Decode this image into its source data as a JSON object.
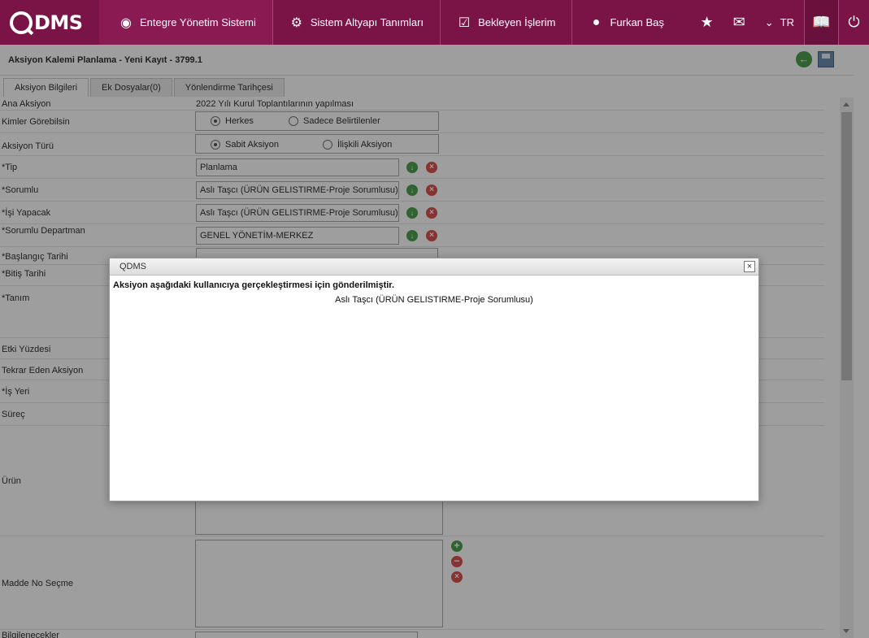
{
  "nav": {
    "logo_text": "DMS",
    "items": [
      {
        "label": "Entegre Yönetim Sistemi",
        "icon": "q-logo-icon"
      },
      {
        "label": "Sistem Altyapı Tanımları",
        "icon": "gear-icon"
      },
      {
        "label": "Bekleyen İşlerim",
        "icon": "clipboard-icon"
      },
      {
        "label": "Furkan Baş",
        "icon": "user-icon"
      }
    ],
    "lang": "TR"
  },
  "page": {
    "title": "Aksiyon Kalemi Planlama - Yeni Kayıt - 3799.1"
  },
  "tabs": [
    {
      "label": "Aksiyon Bilgileri",
      "active": true
    },
    {
      "label": "Ek Dosyalar(0)",
      "active": false
    },
    {
      "label": "Yönlendirme Tarihçesi",
      "active": false
    }
  ],
  "form": {
    "ana_aksiyon": {
      "label": "Ana Aksiyon",
      "value": "2022 Yılı Kurul Toplantılarının yapılması"
    },
    "kimler": {
      "label": "Kimler Görebilsin",
      "options": [
        "Herkes",
        "Sadece Belirtilenler"
      ],
      "selected": "Herkes"
    },
    "aksiyon_turu": {
      "label": "Aksiyon Türü",
      "options": [
        "Sabit Aksiyon",
        "İlişkili Aksiyon"
      ],
      "selected": "Sabit Aksiyon"
    },
    "tip": {
      "label": "*Tip",
      "value": "Planlama"
    },
    "sorumlu": {
      "label": "*Sorumlu",
      "value": "Aslı Taşcı (ÜRÜN GELISTIRME-Proje Sorumlusu)"
    },
    "isi_yapacak": {
      "label": "*İşi Yapacak",
      "value": "Aslı Taşcı (ÜRÜN GELISTIRME-Proje Sorumlusu)"
    },
    "sorumlu_departman": {
      "label": "*Sorumlu Departman",
      "value": "GENEL YÖNETİM-MERKEZ"
    },
    "baslangic": {
      "label": "*Başlangıç Tarihi"
    },
    "bitis": {
      "label": "*Bitiş Tarihi"
    },
    "tanim": {
      "label": "*Tanım"
    },
    "etki": {
      "label": "Etki Yüzdesi"
    },
    "tekrar": {
      "label": "Tekrar Eden Aksiyon"
    },
    "is_yeri": {
      "label": "*İş Yeri"
    },
    "surec": {
      "label": "Süreç"
    },
    "urun": {
      "label": "Ürün"
    },
    "madde": {
      "label": "Madde No Seçme"
    },
    "bilgilenecekler": {
      "label": "Bilgilenecekler"
    }
  },
  "modal": {
    "title": "QDMS",
    "message": "Aksiyon aşağıdaki kullanıcıya gerçekleştirmesi için gönderilmiştir.",
    "user": "Aslı Taşcı (ÜRÜN GELISTIRME-Proje Sorumlusu)"
  }
}
